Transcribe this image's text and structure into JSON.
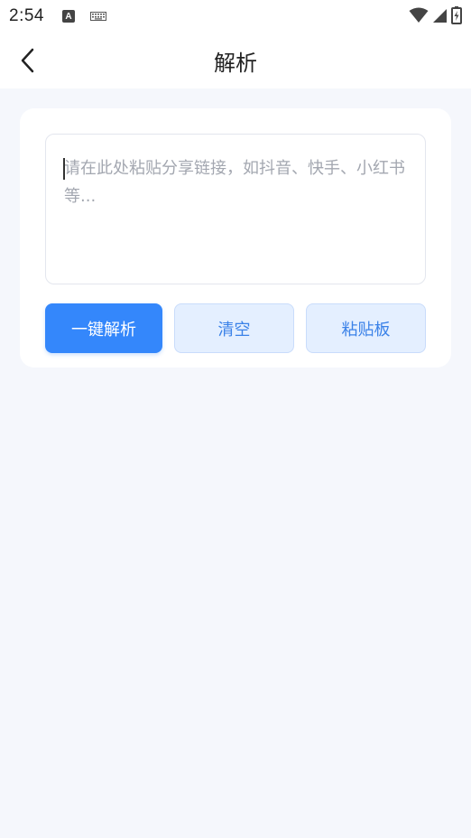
{
  "status_bar": {
    "time": "2:54",
    "icons": [
      "text-a-icon",
      "keyboard-icon",
      "wifi-icon",
      "cell-signal-icon",
      "battery-icon"
    ]
  },
  "header": {
    "title": "解析",
    "back_icon": "chevron-left-icon"
  },
  "parse_card": {
    "input_placeholder": "请在此处粘贴分享链接，如抖音、快手、小红书等...",
    "input_value": "",
    "buttons": {
      "parse": "一键解析",
      "clear": "清空",
      "paste": "粘贴板"
    }
  },
  "colors": {
    "primary": "#3487fb",
    "secondary_bg": "#e4efff",
    "secondary_text": "#3b82e8",
    "page_bg": "#f5f7fc"
  }
}
